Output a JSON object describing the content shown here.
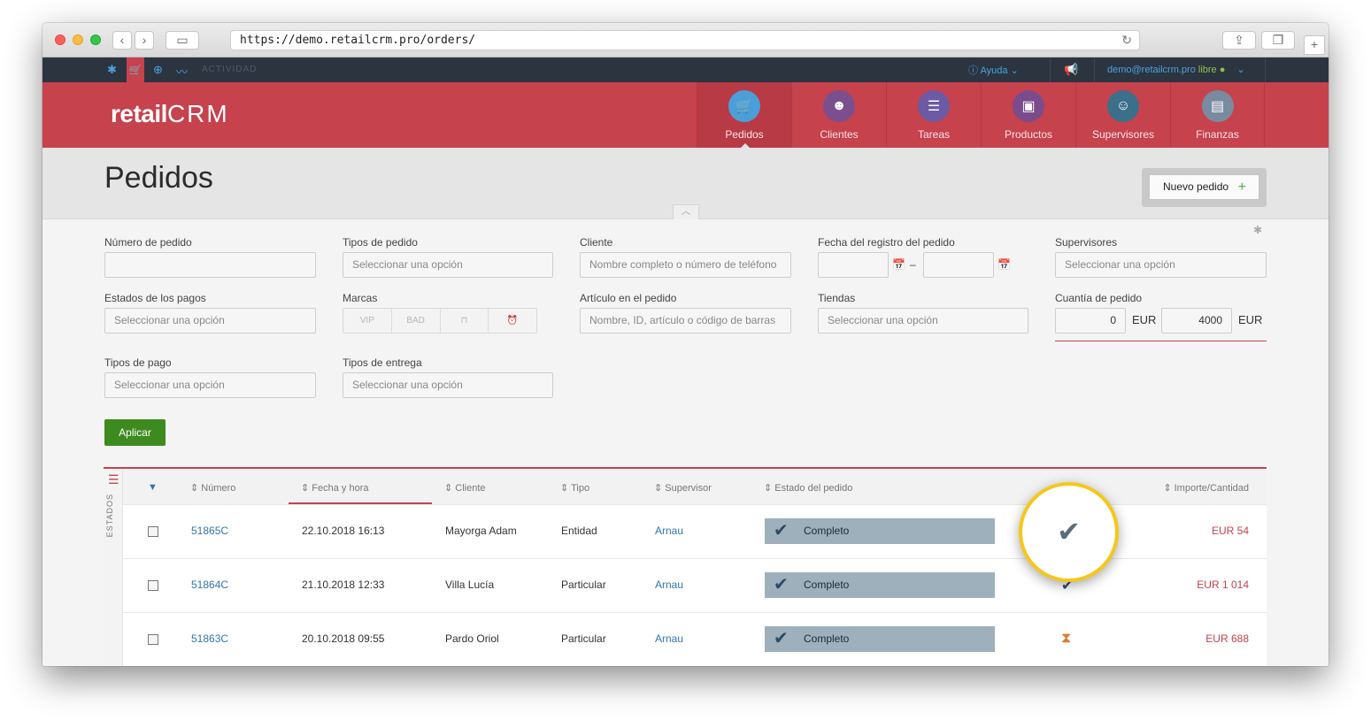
{
  "browser": {
    "url": "https://demo.retailcrm.pro/orders/"
  },
  "topbar": {
    "activity": "ACTIVIDAD",
    "help": "Ayuda",
    "user_email": "demo@retailcrm.pro",
    "user_status": "libre"
  },
  "header": {
    "logo": "retail",
    "logo_crm": "CRM",
    "nav": [
      {
        "label": "Pedidos",
        "icon": "cart-icon",
        "color": "#2c3440"
      },
      {
        "label": "Clientes",
        "icon": "client-avatar-icon",
        "color": "#e8a23c"
      },
      {
        "label": "Tareas",
        "icon": "tasks-chat-icon",
        "color": "#6c5aa5"
      },
      {
        "label": "Productos",
        "icon": "box-icon",
        "color": "#d9b564"
      },
      {
        "label": "Supervisores",
        "icon": "supervisor-avatar-icon",
        "color": "#3b6f8a"
      },
      {
        "label": "Finanzas",
        "icon": "finance-doc-icon",
        "color": "#7a8ba0"
      }
    ]
  },
  "page": {
    "title": "Pedidos",
    "new_order": "Nuevo pedido"
  },
  "filters": {
    "order_number": {
      "label": "Número de pedido",
      "value": ""
    },
    "order_types": {
      "label": "Tipos de pedido",
      "placeholder": "Seleccionar una opción"
    },
    "client": {
      "label": "Cliente",
      "placeholder": "Nombre completo o número de teléfono"
    },
    "reg_date": {
      "label": "Fecha del registro del pedido",
      "separator": "–"
    },
    "supervisors": {
      "label": "Supervisores",
      "placeholder": "Seleccionar una opción"
    },
    "payment_states": {
      "label": "Estados de los pagos",
      "placeholder": "Seleccionar una opción"
    },
    "marks": {
      "label": "Marcas",
      "items": [
        "VIP",
        "BAD"
      ]
    },
    "item_in_order": {
      "label": "Artículo en el pedido",
      "placeholder": "Nombre, ID, artículo o código de barras"
    },
    "shops": {
      "label": "Tiendas",
      "placeholder": "Seleccionar una opción"
    },
    "order_amount": {
      "label": "Cuantía de pedido",
      "min": "0",
      "max": "4000",
      "currency": "EUR"
    },
    "payment_types": {
      "label": "Tipos de pago",
      "placeholder": "Seleccionar una opción"
    },
    "delivery_types": {
      "label": "Tipos de entrega",
      "placeholder": "Seleccionar una opción"
    },
    "apply": "Aplicar"
  },
  "table": {
    "side_label": "ESTADOS",
    "columns": [
      "Número",
      "Fecha y hora",
      "Cliente",
      "Tipo",
      "Supervisor",
      "Estado del pedido",
      "Importe/Cantidad"
    ],
    "rows": [
      {
        "number": "51865C",
        "date": "22.10.2018 16:13",
        "client": "Mayorga Adam",
        "type": "Entidad",
        "supervisor": "Arnau",
        "status": "Completo",
        "amount": "EUR 54"
      },
      {
        "number": "51864C",
        "date": "21.10.2018 12:33",
        "client": "Villa Lucía",
        "type": "Particular",
        "supervisor": "Arnau",
        "status": "Completo",
        "amount": "EUR 1 014"
      },
      {
        "number": "51863C",
        "date": "20.10.2018 09:55",
        "client": "Pardo Oriol",
        "type": "Particular",
        "supervisor": "Arnau",
        "status": "Completo",
        "amount": "EUR 688"
      }
    ]
  },
  "colors": {
    "brand": "#c6424d",
    "topbar": "#2c3440",
    "highlight": "#f5c71a",
    "status": "#9db0bc"
  }
}
